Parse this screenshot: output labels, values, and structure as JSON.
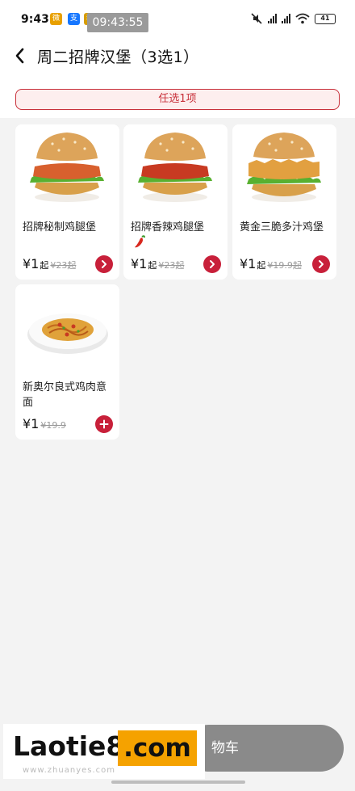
{
  "status_bar": {
    "time": "9:43",
    "clock_overlay": "09:43:55",
    "app_icons": [
      {
        "name": "weibo-icon",
        "glyph": "微",
        "color": "#e8a000"
      },
      {
        "name": "alipay-icon",
        "glyph": "支",
        "color": "#1677ff"
      },
      {
        "name": "news-icon",
        "glyph": "新",
        "color": "#d69c00"
      }
    ],
    "battery": "41"
  },
  "header": {
    "back_icon": "chevron-left-icon",
    "title": "周二招牌汉堡（3选1）"
  },
  "select_hint": "任选1项",
  "products": [
    {
      "name": "招牌秘制鸡腿堡",
      "price": "¥1",
      "suffix": "起",
      "original_price": "¥23起",
      "action": "chevron-right-icon",
      "image": "burger-icon",
      "badge": ""
    },
    {
      "name": "招牌香辣鸡腿堡",
      "price": "¥1",
      "suffix": "起",
      "original_price": "¥23起",
      "action": "chevron-right-icon",
      "image": "burger-icon",
      "badge": "chili-pepper-icon"
    },
    {
      "name": "黄金三脆多汁鸡堡",
      "price": "¥1",
      "suffix": "起",
      "original_price": "¥19.9起",
      "action": "chevron-right-icon",
      "image": "burger-icon",
      "badge": ""
    },
    {
      "name": "新奥尔良式鸡肉意面",
      "price": "¥1",
      "suffix": "",
      "original_price": "¥19.9",
      "action": "plus-icon",
      "image": "pasta-icon",
      "badge": ""
    }
  ],
  "cart": {
    "label": "物车"
  },
  "watermark": {
    "text": "Laotie8",
    "box": ".com",
    "sub": "www.zhuanyes.com"
  },
  "colors": {
    "accent": "#c8203a",
    "hint_bg": "#fdeeee",
    "cart_bg": "#8a8a8a",
    "watermark_box": "#f5a200"
  }
}
